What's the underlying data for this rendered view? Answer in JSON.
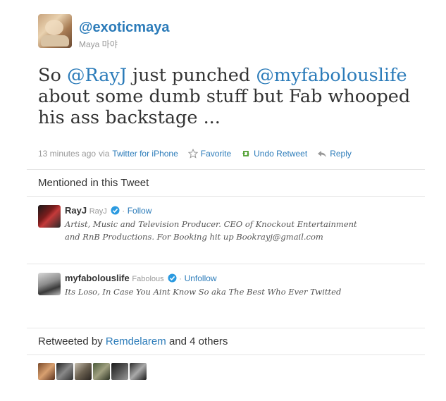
{
  "author": {
    "screen_name": "@exoticmaya",
    "full_name": "Maya 마야"
  },
  "tweet": {
    "text_1": "So ",
    "mention_1": "@RayJ",
    "text_2": " just punched ",
    "mention_2": "@myfabolouslife",
    "text_3": " about some dumb stuff but Fab whooped his ass backstage ..."
  },
  "meta": {
    "time": "13 minutes ago",
    "via": "via",
    "client": "Twitter for iPhone",
    "favorite": "Favorite",
    "undo_retweet": "Undo Retweet",
    "reply": "Reply"
  },
  "mentioned": {
    "title": "Mentioned in this Tweet",
    "users": [
      {
        "username": "RayJ",
        "display_name": "RayJ",
        "action": "Follow",
        "bio": "Artist, Music and Television Producer. CEO of Knockout Entertainment and RnB Productions. For Booking hit up Bookrayj@gmail.com"
      },
      {
        "username": "myfabolouslife",
        "display_name": "Fabolous",
        "action": "Unfollow",
        "bio": "Its Loso, In Case You Aint Know So aka The Best Who Ever Twitted"
      }
    ]
  },
  "retweeted": {
    "prefix": "Retweeted by",
    "user": "Remdelarem",
    "suffix": "and 4 others",
    "avatar_count": 6
  },
  "colors": {
    "link": "#2b7bb9",
    "retweet_green": "#4b9c2b",
    "text": "#333333",
    "muted": "#999999"
  },
  "icons": {
    "favorite": "star-outline-icon",
    "retweet": "retweet-icon",
    "reply": "reply-arrow-icon",
    "verified": "verified-badge-icon"
  }
}
